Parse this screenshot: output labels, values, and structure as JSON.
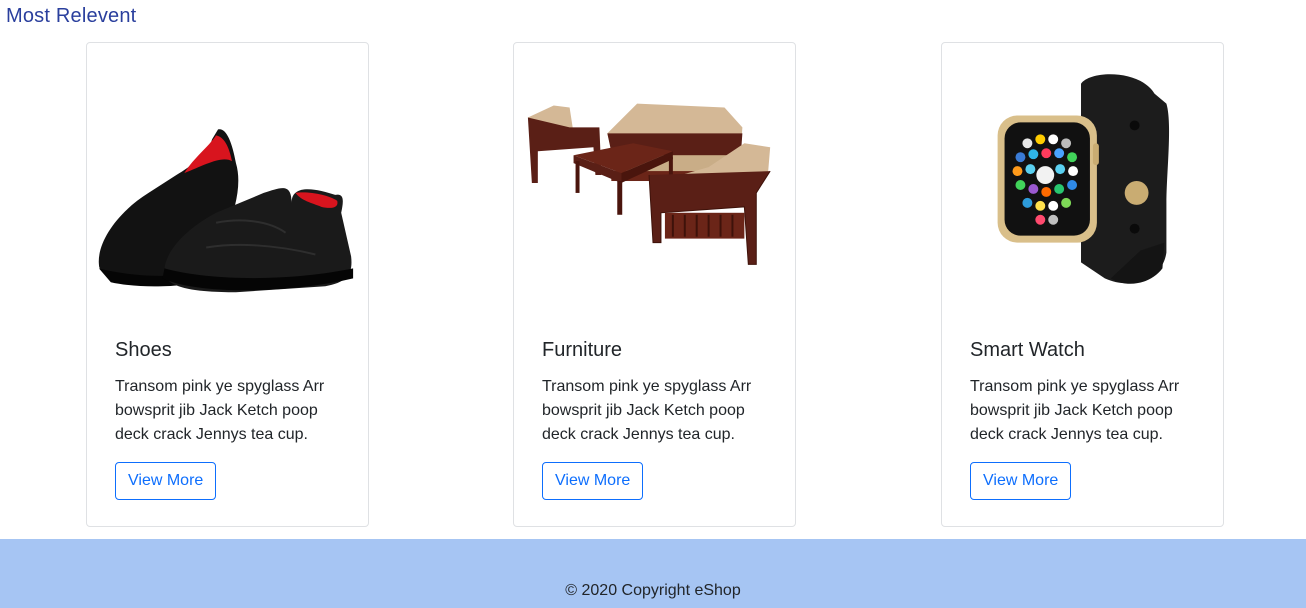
{
  "section": {
    "title": "Most Relevent"
  },
  "cards": [
    {
      "title": "Shoes",
      "text": "Transom pink ye spyglass Arr bowsprit jib Jack Ketch poop deck crack Jennys tea cup.",
      "button": "View More",
      "image_icon": "shoes-image"
    },
    {
      "title": "Furniture",
      "text": "Transom pink ye spyglass Arr bowsprit jib Jack Ketch poop deck crack Jennys tea cup.",
      "button": "View More",
      "image_icon": "sofa-set-image"
    },
    {
      "title": "Smart Watch",
      "text": "Transom pink ye spyglass Arr bowsprit jib Jack Ketch poop deck crack Jennys tea cup.",
      "button": "View More",
      "image_icon": "smart-watch-image"
    }
  ],
  "footer": {
    "copyright": "© 2020 Copyright eShop"
  },
  "colors": {
    "title": "#2a3f9d",
    "button": "#0d6efd",
    "footer_bg": "#a6c5f3"
  }
}
